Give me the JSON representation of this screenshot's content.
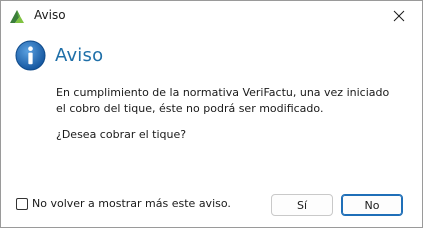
{
  "window": {
    "title": "Aviso"
  },
  "heading": {
    "text": "Aviso"
  },
  "message": {
    "line1": "En cumplimiento de la normativa VeriFactu, una vez iniciado",
    "line2": "el cobro del tique, éste no podrá ser modificado.",
    "question": "¿Desea cobrar el tique?"
  },
  "options": {
    "dont_show_label": "No volver a mostrar más este aviso.",
    "dont_show_checked": false
  },
  "buttons": {
    "yes_label": "Sí",
    "no_label": "No"
  },
  "icons": {
    "app": "app-logo-icon",
    "close": "close-icon",
    "info": "info-icon"
  },
  "colors": {
    "accent": "#1f6fa8",
    "default_button_border": "#1f6fb8"
  }
}
